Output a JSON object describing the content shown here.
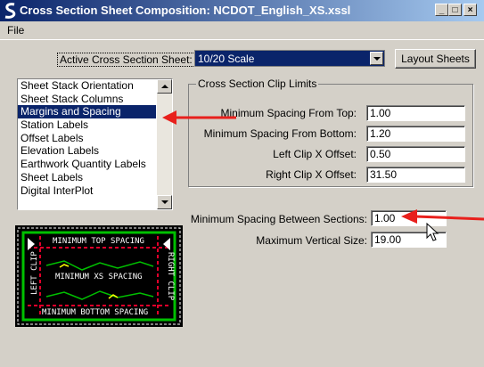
{
  "window": {
    "title": "Cross Section Sheet Composition: NCDOT_English_XS.xssl",
    "minimize_label": "_",
    "maximize_label": "□",
    "close_label": "×"
  },
  "menu": {
    "file_label": "File"
  },
  "sheet": {
    "label": "Active Cross Section Sheet:",
    "selected": "10/20 Scale",
    "layout_button": "Layout Sheets"
  },
  "categories": [
    {
      "label": "Sheet Stack Orientation"
    },
    {
      "label": "Sheet Stack Columns"
    },
    {
      "label": "Margins and Spacing",
      "selected": true
    },
    {
      "label": "Station Labels"
    },
    {
      "label": "Offset Labels"
    },
    {
      "label": "Elevation Labels"
    },
    {
      "label": "Earthwork Quantity Labels"
    },
    {
      "label": "Sheet Labels"
    },
    {
      "label": "Digital InterPlot"
    }
  ],
  "clip": {
    "title": "Cross Section Clip Limits",
    "min_top_label": "Minimum Spacing From Top:",
    "min_top_value": "1.00",
    "min_bottom_label": "Minimum Spacing From Bottom:",
    "min_bottom_value": "1.20",
    "left_label": "Left Clip X Offset:",
    "left_value": "0.50",
    "right_label": "Right Clip X Offset:",
    "right_value": "31.50"
  },
  "spacing": {
    "between_label": "Minimum Spacing Between Sections:",
    "between_value": "1.00",
    "max_vertical_label": "Maximum Vertical Size:",
    "max_vertical_value": "19.00"
  },
  "preview": {
    "top_text": "MINIMUM TOP SPACING",
    "xs_text": "MINIMUM XS SPACING",
    "bottom_text": "MINIMUM BOTTOM SPACING",
    "left_text": "LEFT CLIP",
    "right_text": "RIGHT CLIP"
  },
  "colors": {
    "title_start": "#0a246a",
    "title_end": "#a6caf0",
    "selection": "#0a246a",
    "annotation_arrow": "#e8201c",
    "preview_frame": "#00c000",
    "preview_dash": "#e0002a"
  }
}
